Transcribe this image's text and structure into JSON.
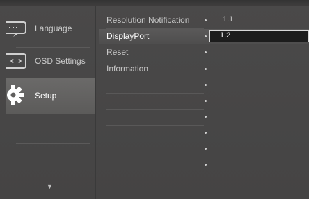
{
  "menu": [
    {
      "label": "Language",
      "icon": "language-icon"
    },
    {
      "label": "OSD Settings",
      "icon": "osd-settings-icon"
    },
    {
      "label": "Setup",
      "icon": "gear-icon",
      "selected": true
    }
  ],
  "scroll_down": "▼",
  "settings": [
    {
      "label": "Resolution Notification",
      "value": "1.1"
    },
    {
      "label": "DisplayPort",
      "value": "1.2",
      "selected": true
    },
    {
      "label": "Reset",
      "value": ""
    },
    {
      "label": "Information",
      "value": ""
    }
  ],
  "bullet_char": "•",
  "colors": {
    "selected_tab": "#5f5e5d",
    "value_box": "#1c1c1c",
    "background": "#484747"
  }
}
